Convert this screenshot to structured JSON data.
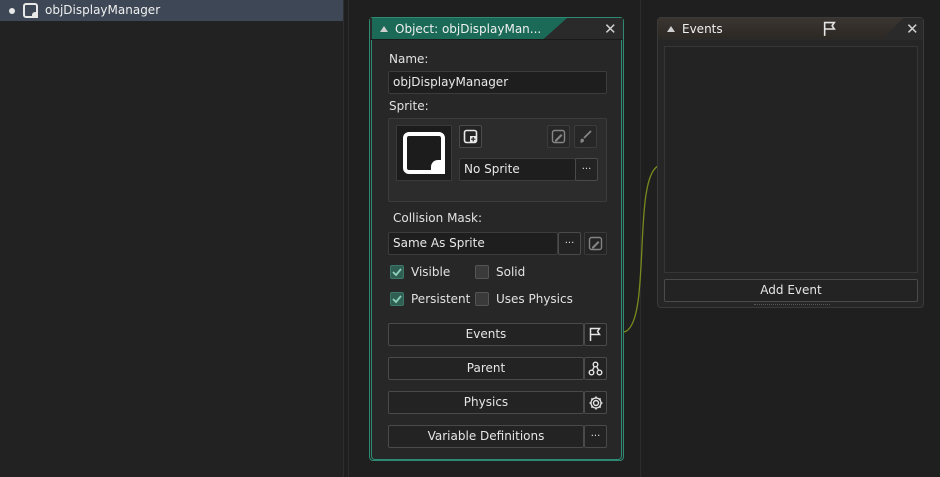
{
  "asset_browser": {
    "selected_item": "objDisplayManager"
  },
  "object_window": {
    "title": "Object: objDisplayMan...",
    "name_label": "Name:",
    "name_value": "objDisplayManager",
    "sprite_label": "Sprite:",
    "sprite_value": "No Sprite",
    "collision_mask_label": "Collision Mask:",
    "collision_mask_value": "Same As Sprite",
    "more_glyph": "···",
    "checkboxes": {
      "visible": {
        "label": "Visible",
        "checked": true
      },
      "solid": {
        "label": "Solid",
        "checked": false
      },
      "persistent": {
        "label": "Persistent",
        "checked": true
      },
      "uses_physics": {
        "label": "Uses Physics",
        "checked": false
      }
    },
    "buttons": {
      "events": "Events",
      "parent": "Parent",
      "physics": "Physics",
      "variable_definitions": "Variable Definitions"
    },
    "accent_color": "#2e8a72"
  },
  "events_window": {
    "title": "Events",
    "add_event": "Add Event"
  },
  "colors": {
    "selection": "#3d4755",
    "link_line": "#7a8a1e",
    "check_accent": "#2f5f52"
  }
}
